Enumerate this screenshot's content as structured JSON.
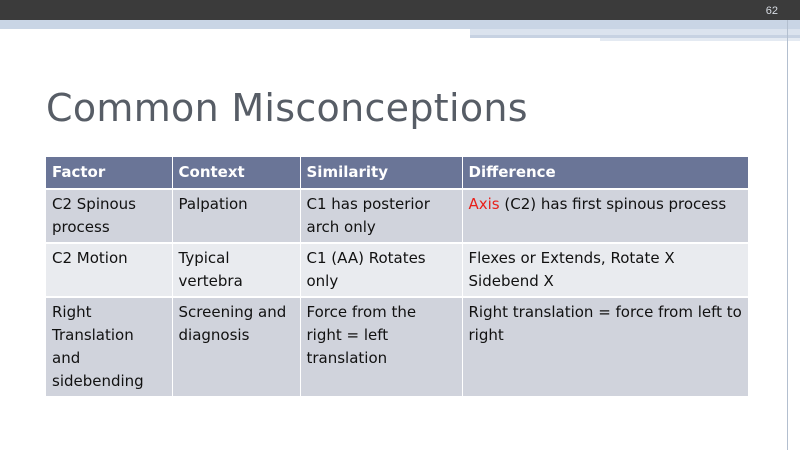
{
  "slide": {
    "page_number": "62",
    "title": "Common Misconceptions"
  },
  "colors": {
    "header_bg": "#6a7597",
    "row_dark": "#d0d3dc",
    "row_light": "#e9ebef",
    "highlight_red": "#e8201a",
    "title_color": "#575d66"
  },
  "table": {
    "headers": [
      "Factor",
      "Context",
      "Similarity",
      "Difference"
    ],
    "rows": [
      {
        "factor": "C2 Spinous process",
        "context": "Palpation",
        "similarity": "C1  has posterior arch only",
        "difference_red": "Axis",
        "difference_rest": " (C2) has first spinous process"
      },
      {
        "factor": "C2 Motion",
        "context": "Typical vertebra",
        "similarity": "C1 (AA) Rotates only",
        "difference": "Flexes or Extends, Rotate X Sidebend X"
      },
      {
        "factor": "Right Translation and sidebending",
        "context": "Screening and diagnosis",
        "similarity": "Force from the right = left translation",
        "difference": "Right translation = force from left to right"
      }
    ]
  }
}
